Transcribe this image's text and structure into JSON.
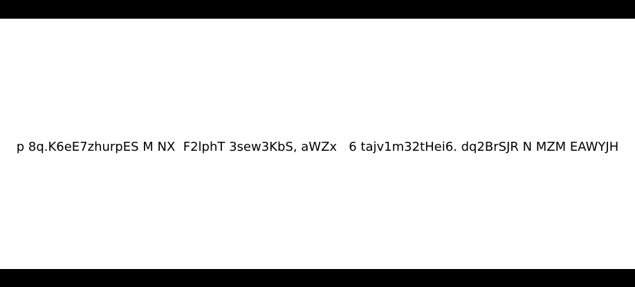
{
  "main": {
    "text": "p 8q.K6eE7zhurpES M NX  F2lphT 3sew3KbS, aWZx   6 tajv1m32tHei6. dq2BrSJR N MZM EAWYJH"
  },
  "colors": {
    "bar": "#000000",
    "background": "#ffffff",
    "text": "#000000"
  }
}
